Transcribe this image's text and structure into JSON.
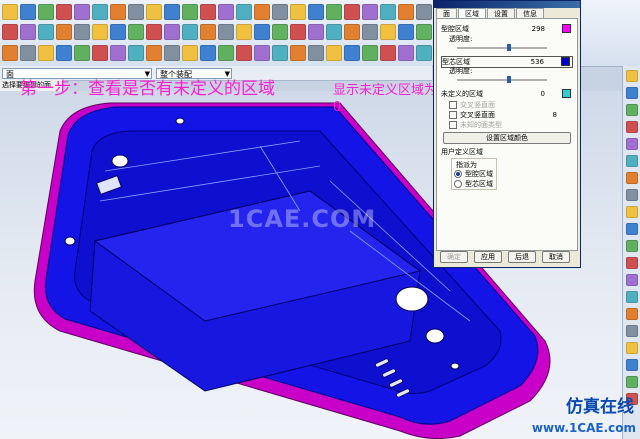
{
  "annotations": {
    "step1": "第一步：查看是否有未定义的区域",
    "step2": "显示未定义区域为0"
  },
  "selection_bar": {
    "filter_value": "面",
    "scope_value": "整个装配",
    "status_text": "选择要编辑的面"
  },
  "watermark": "1CAE.COM",
  "brand": {
    "line1": "仿真在线",
    "line2": "www.1CAE.com"
  },
  "dialog": {
    "tabs": [
      "面",
      "区域",
      "设置",
      "信息"
    ],
    "active_tab": "区域",
    "cavity_region": {
      "label": "型腔区域",
      "count": "298",
      "color": "#ff00ff",
      "opacity_label": "透明度:"
    },
    "core_region": {
      "label": "型芯区域",
      "count": "536",
      "color": "#0000cc",
      "opacity_label": "透明度:"
    },
    "undefined_region": {
      "label": "未定义的区域",
      "count": "0",
      "color": "#33cccc"
    },
    "undefined_items": [
      {
        "label": "交叉竖直面",
        "value": "",
        "enabled": false
      },
      {
        "label": "交叉竖直面",
        "value": "8",
        "enabled": true
      },
      {
        "label": "未知的面类型",
        "value": "",
        "enabled": false
      }
    ],
    "set_color_button": "设置区域颜色",
    "user_defined_section": "用户定义区域",
    "assign_to_label": "指派为",
    "assign_options": [
      {
        "label": "型腔区域",
        "selected": true
      },
      {
        "label": "型芯区域",
        "selected": false
      }
    ],
    "footer_buttons": [
      "确定",
      "应用",
      "后退",
      "取消"
    ]
  },
  "colors": {
    "cavity": "#ff00ff",
    "core": "#0000cc",
    "undefined": "#33cccc",
    "annotation": "#ff1fd0"
  }
}
